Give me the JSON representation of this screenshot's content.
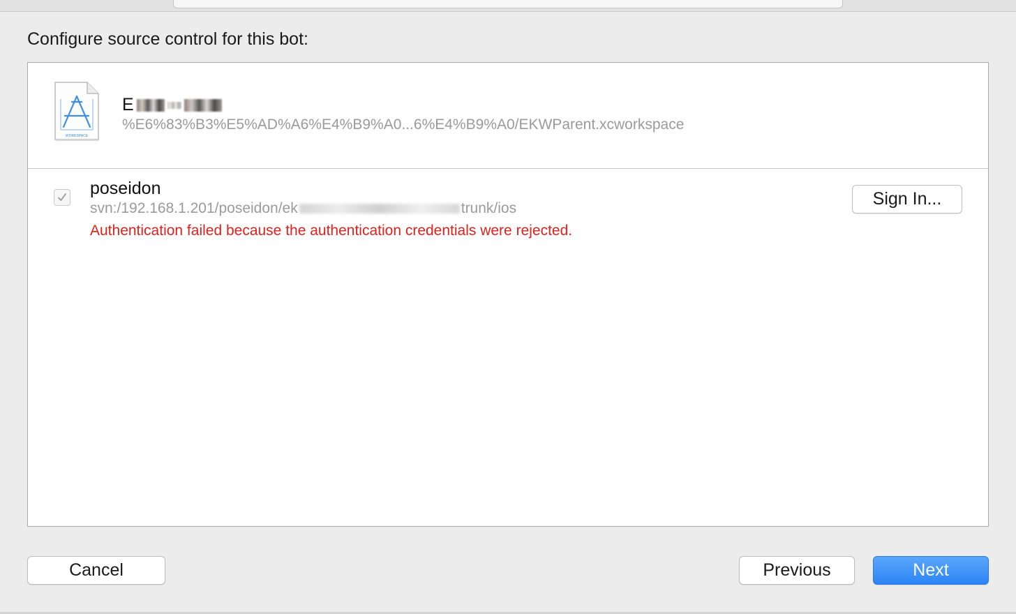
{
  "sheet": {
    "title": "Configure source control for this bot:"
  },
  "workspace": {
    "icon": "xcode-workspace-icon",
    "icon_label": "WORKSPACE",
    "name_prefix": "E",
    "path": "%E6%83%B3%E5%AD%A6%E4%B9%A0...6%E4%B9%A0/EKWParent.xcworkspace"
  },
  "repository": {
    "checked": true,
    "name": "poseidon",
    "url_prefix": "svn:/192.168.1.201/poseidon/ek",
    "url_suffix": "trunk/ios",
    "error": "Authentication failed because the authentication credentials were rejected.",
    "sign_in_label": "Sign In..."
  },
  "footer": {
    "cancel_label": "Cancel",
    "previous_label": "Previous",
    "next_label": "Next"
  },
  "colors": {
    "error": "#e0201b",
    "accent": "#2d84f5",
    "muted_text": "#9a9a9a"
  }
}
